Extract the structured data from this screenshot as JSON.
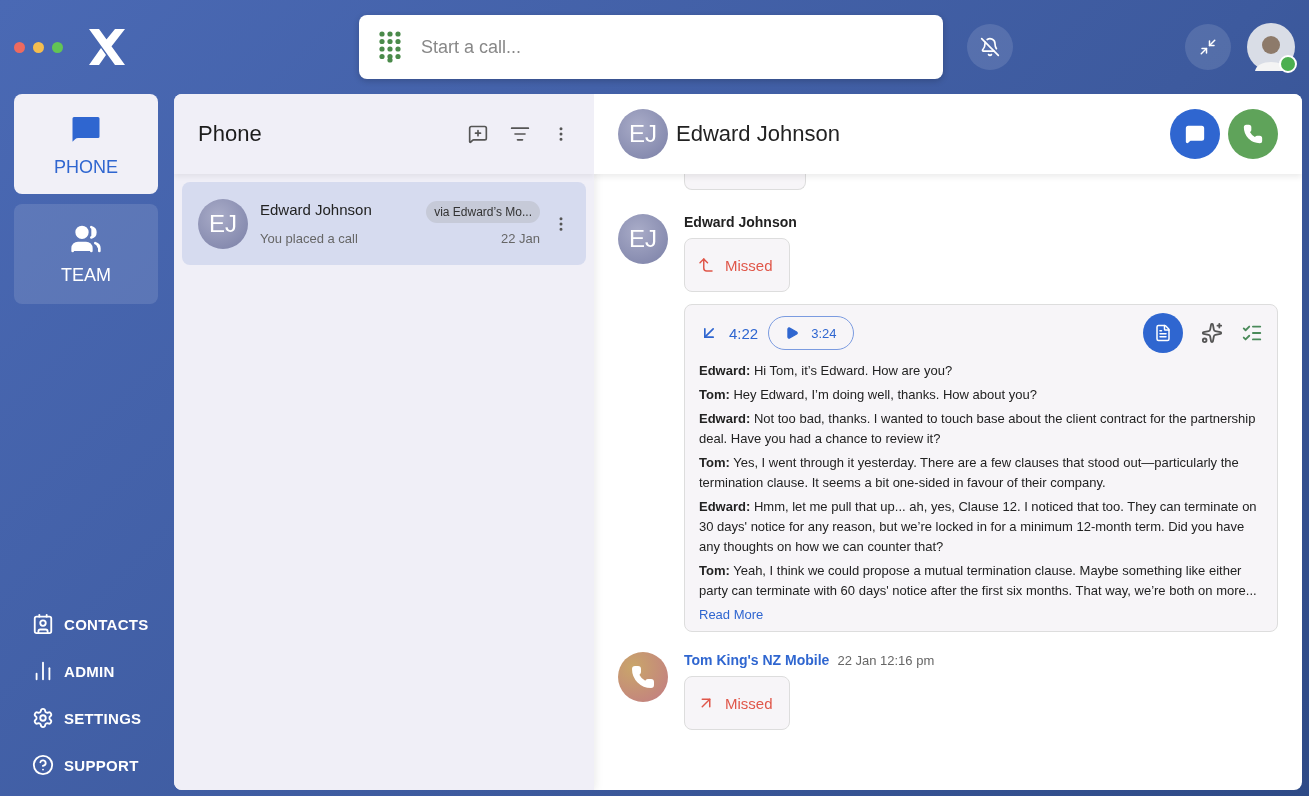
{
  "search": {
    "placeholder": "Start a call..."
  },
  "user": {
    "online": true
  },
  "nav": [
    {
      "label": "PHONE",
      "selected": true
    },
    {
      "label": "TEAM",
      "selected": false
    }
  ],
  "bottom_nav": [
    {
      "label": "CONTACTS"
    },
    {
      "label": "ADMIN"
    },
    {
      "label": "SETTINGS"
    },
    {
      "label": "SUPPORT"
    }
  ],
  "list": {
    "title": "Phone",
    "items": [
      {
        "initials": "EJ",
        "name": "Edward Johnson",
        "badge": "via Edward’s Mo...",
        "subtitle": "You placed a call",
        "date": "22 Jan",
        "selected": true
      }
    ]
  },
  "conversation": {
    "initials": "EJ",
    "name": "Edward Johnson",
    "events": [
      {
        "kind": "missed",
        "sender": "Edward Johnson",
        "avatar": "EJ",
        "incoming": true,
        "label": "Missed"
      },
      {
        "kind": "call",
        "duration": "4:22",
        "recording": "3:24",
        "transcript": [
          "**Edward:** Hi Tom, it’s Edward. How are you?",
          "**Tom:** Hey Edward, I’m doing well, thanks. How about you?",
          "**Edward:** Not too bad, thanks. I wanted to touch base about the client contract for the partnership deal. Have you had a chance to review it?",
          "**Tom:** Yes, I went through it yesterday. There are a few clauses that stood out—particularly the termination clause. It seems a bit one-sided in favour of their company.",
          "**Edward:** Hmm, let me pull that up... ah, yes, Clause 12. I noticed that too. They can terminate on 30 days' notice for any reason, but we’re locked in for a minimum 12-month term. Did you have any thoughts on how we can counter that?",
          "**Tom:** Yeah, I think we could propose a mutual termination clause. Maybe something like either party can terminate with 60 days' notice after the first six months. That way, we’re both on more..."
        ],
        "read_more": "Read More"
      },
      {
        "kind": "missed",
        "sender": "Tom King's NZ Mobile",
        "time": "22 Jan 12:16 pm",
        "incoming": false,
        "label": "Missed"
      }
    ]
  }
}
